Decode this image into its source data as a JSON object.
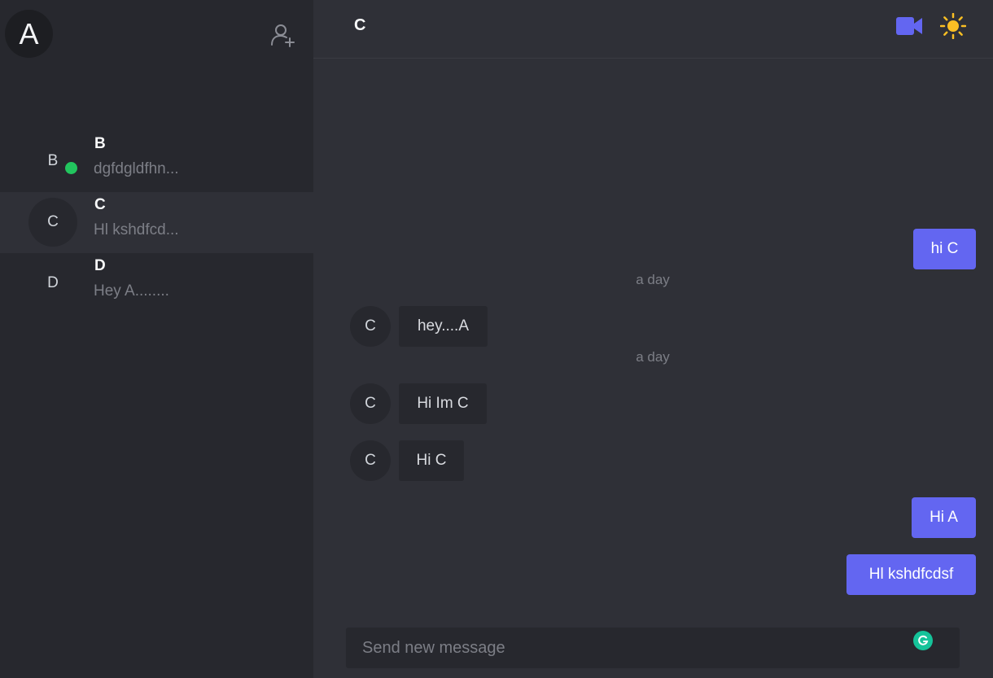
{
  "user": {
    "initial": "A"
  },
  "contacts": [
    {
      "initial": "B",
      "name": "B",
      "preview": "dgfdgldfhn...",
      "online": true
    },
    {
      "initial": "C",
      "name": "C",
      "preview": "Hl kshdfcd...",
      "active": true
    },
    {
      "initial": "D",
      "name": "D",
      "preview": "Hey A........"
    }
  ],
  "chat": {
    "title": "C",
    "messages": [
      {
        "kind": "out",
        "text": "hi C"
      },
      {
        "kind": "time",
        "text": "a day"
      },
      {
        "kind": "in",
        "avatar": "C",
        "text": "hey....A"
      },
      {
        "kind": "time",
        "text": "a day"
      },
      {
        "kind": "in",
        "avatar": "C",
        "text": "Hi Im C"
      },
      {
        "kind": "in",
        "avatar": "C",
        "text": "Hi C"
      },
      {
        "kind": "out",
        "text": "Hi A"
      },
      {
        "kind": "out",
        "text": "Hl kshdfcdsf"
      }
    ]
  },
  "composer": {
    "placeholder": "Send new message"
  },
  "colors": {
    "accent": "#6366f1",
    "online": "#22c55e",
    "sun": "#fbbf24",
    "grammarly": "#15c39a"
  },
  "icons": {
    "add_user": "add-user-icon",
    "video": "video-camera-icon",
    "theme": "sun-icon",
    "grammarly": "grammarly-icon"
  }
}
